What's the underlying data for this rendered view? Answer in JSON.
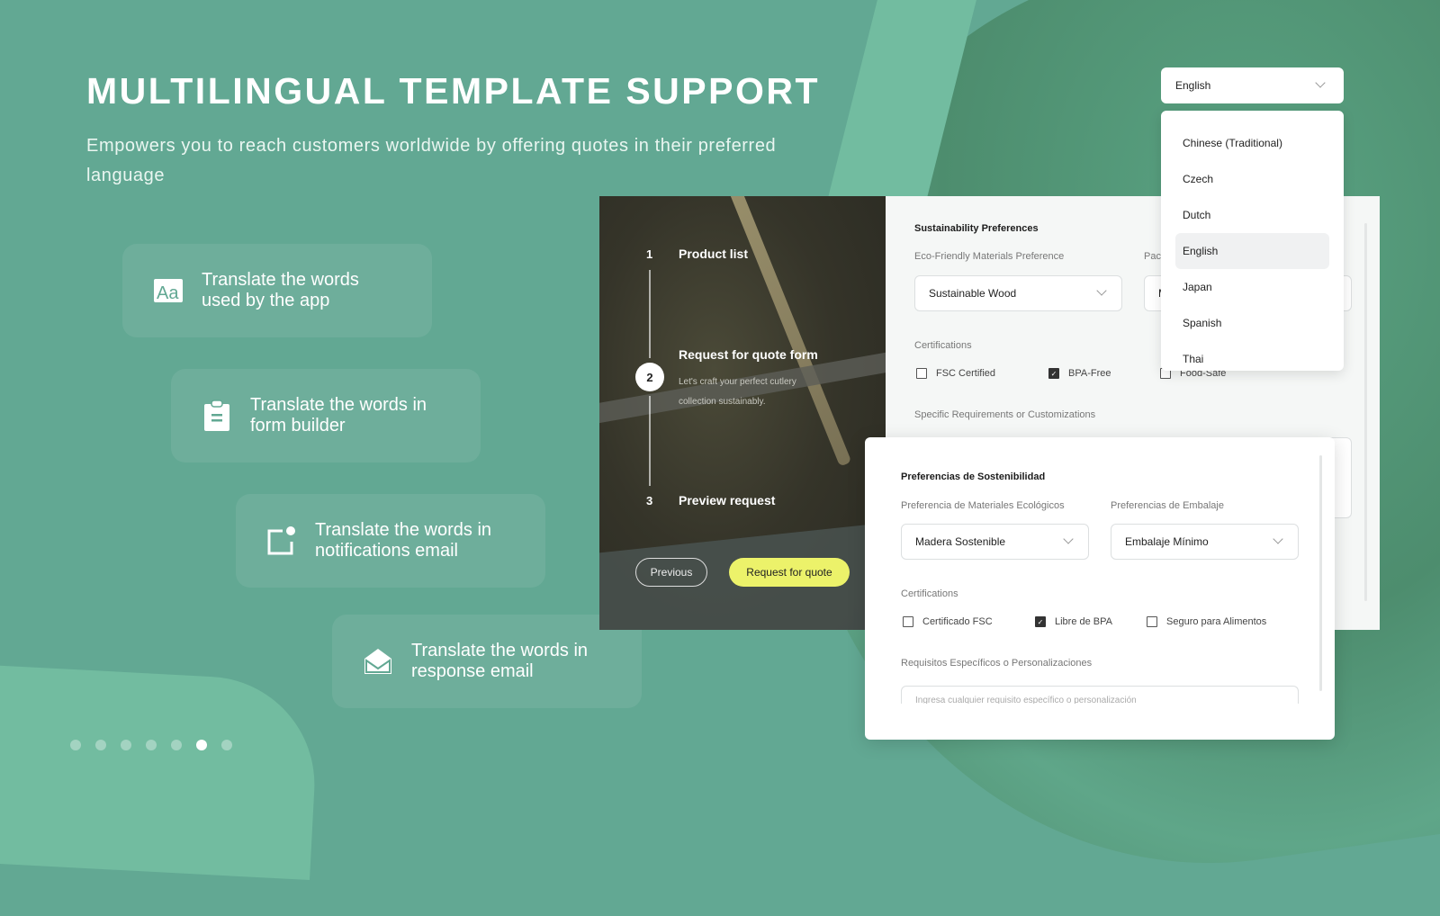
{
  "hero": {
    "title": "MULTILINGUAL TEMPLATE SUPPORT",
    "subtitle": "Empowers you to reach customers worldwide by offering quotes in their preferred language"
  },
  "features": [
    {
      "icon": "font-aa-icon",
      "line1": "Translate the words",
      "line2": "used by the app"
    },
    {
      "icon": "clipboard-icon",
      "line1": "Translate the words in",
      "line2": "form builder"
    },
    {
      "icon": "notification-icon",
      "line1": "Translate the words in",
      "line2": "notifications email"
    },
    {
      "icon": "envelope-open-icon",
      "line1": "Translate the words in",
      "line2": "response email"
    }
  ],
  "carousel": {
    "total": 7,
    "active_index": 5
  },
  "stepper": {
    "steps": [
      {
        "num": "1",
        "label": "Product list"
      },
      {
        "num": "2",
        "label": "Request for quote form",
        "description": "Let's craft your perfect cutlery collection sustainably."
      },
      {
        "num": "3",
        "label": "Preview request"
      }
    ],
    "current": 2,
    "previous_label": "Previous",
    "submit_label": "Request for quote"
  },
  "form_en": {
    "section": "Sustainability Preferences",
    "materials_label": "Eco-Friendly Materials Preference",
    "materials_value": "Sustainable Wood",
    "packaging_label_partial": "Pac",
    "packaging_value_partial": "M",
    "certifications_label": "Certifications",
    "certifications": [
      {
        "label": "FSC Certified",
        "checked": false
      },
      {
        "label": "BPA-Free",
        "checked": true
      },
      {
        "label": "Food-Safe",
        "checked": false
      }
    ],
    "requirements_label": "Specific Requirements or Customizations"
  },
  "form_es": {
    "section": "Preferencias de Sostenibilidad",
    "materials_label": "Preferencia de Materiales Ecológicos",
    "materials_value": "Madera Sostenible",
    "packaging_label": "Preferencias de Embalaje",
    "packaging_value": "Embalaje Mínimo",
    "certifications_label": "Certifications",
    "certifications": [
      {
        "label": "Certificado FSC",
        "checked": false
      },
      {
        "label": "Libre de BPA",
        "checked": true
      },
      {
        "label": "Seguro para Alimentos",
        "checked": false
      }
    ],
    "requirements_label": "Requisitos Específicos o Personalizaciones",
    "requirements_placeholder": "Ingresa cualquier requisito específico o personalización"
  },
  "language": {
    "selected": "English",
    "options": [
      "Chinese (Traditional)",
      "Czech",
      "Dutch",
      "English",
      "Japan",
      "Spanish",
      "Thai"
    ]
  },
  "colors": {
    "background": "#62a893",
    "accent_button": "#ecf26a",
    "card": "rgba(255,255,255,0.08)"
  }
}
